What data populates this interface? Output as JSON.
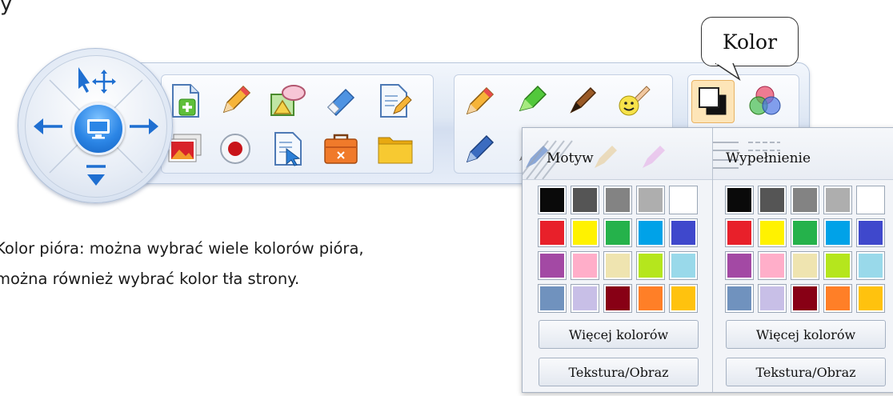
{
  "top_fragment": "y",
  "callout": {
    "label": "Kolor"
  },
  "description": {
    "line1": "Kolor pióra: można wybrać wiele kolorów pióra,",
    "line2": "można również wybrać kolor tła strony."
  },
  "toolbar": {
    "nav_icons": [
      "select-move-icon",
      "left-arrow-icon",
      "right-arrow-icon",
      "down-arrow-icon",
      "monitor-icon"
    ],
    "group1_row1": [
      "new-page-icon",
      "pencil-icon",
      "shapes-icon",
      "eraser-icon",
      "edit-page-icon"
    ],
    "group1_row2": [
      "image-icon",
      "record-icon",
      "document-pointer-icon",
      "toolbox-icon",
      "folder-icon"
    ],
    "group2_row1": [
      "pen-icon",
      "highlighter-icon",
      "brush-pen-icon",
      "smiley-brush-icon"
    ],
    "group2_row2": [
      "blue-pen-icon",
      "texture-pen-icon",
      "gold-pen-icon",
      "pink-pen-icon"
    ],
    "group3_row1": [
      "color-icon",
      "fill-icon"
    ],
    "group3_row2": [
      "line-thickness-icon",
      "line-style-icon"
    ]
  },
  "color_popup": {
    "left_tab": "Motyw",
    "right_tab": "Wypełnienie",
    "more_colors": "Więcej kolorów",
    "texture": "Tekstura/Obraz",
    "palette": [
      [
        "#0a0a0a",
        "#555555",
        "#838383",
        "#aeaeae",
        "#ffffff"
      ],
      [
        "#e8202a",
        "#fff200",
        "#25b24b",
        "#00a2e8",
        "#3f48cc"
      ],
      [
        "#a349a4",
        "#ffaec9",
        "#efe4b0",
        "#b5e61d",
        "#99d9ea"
      ],
      [
        "#7092be",
        "#c8bfe7",
        "#880015",
        "#ff7f27",
        "#ffc20e"
      ]
    ]
  }
}
